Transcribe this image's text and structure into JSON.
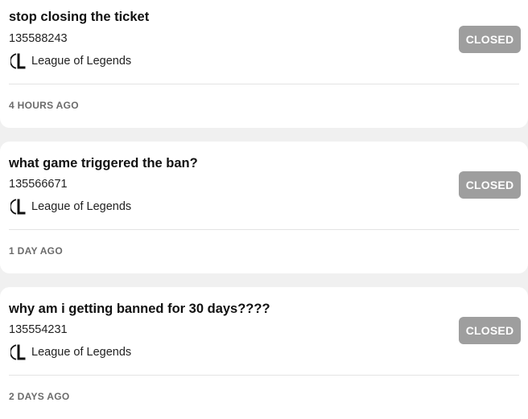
{
  "tickets": [
    {
      "title": "stop closing the ticket",
      "id": "135588243",
      "game": "League of Legends",
      "game_icon": "league-of-legends-icon",
      "status": "CLOSED",
      "time": "4 HOURS AGO"
    },
    {
      "title": "what game triggered the ban?",
      "id": "135566671",
      "game": "League of Legends",
      "game_icon": "league-of-legends-icon",
      "status": "CLOSED",
      "time": "1 DAY AGO"
    },
    {
      "title": "why am i getting banned for 30 days????",
      "id": "135554231",
      "game": "League of Legends",
      "game_icon": "league-of-legends-icon",
      "status": "CLOSED",
      "time": "2 DAYS AGO"
    }
  ],
  "colors": {
    "background": "#f0f0f0",
    "card": "#ffffff",
    "status_badge": "#9e9e9e",
    "timestamp": "#6b6b6b"
  }
}
